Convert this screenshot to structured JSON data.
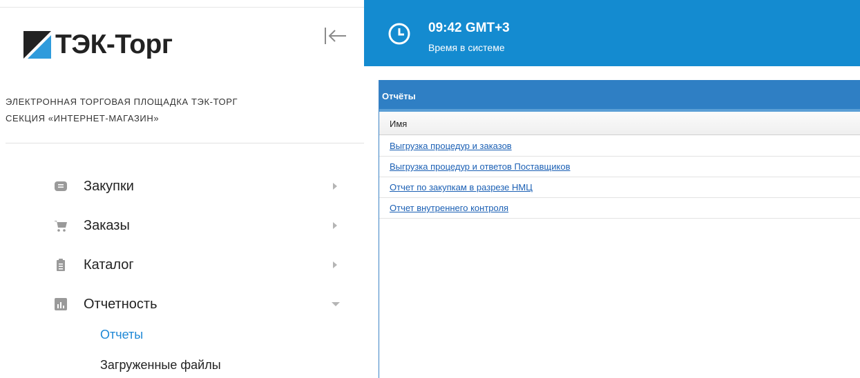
{
  "brand": {
    "logo_text": "ТЭК-Торг",
    "subtitle_line1": "Электронная торговая площадка ТЭК-Торг",
    "subtitle_line2": "Секция «Интернет-магазин»"
  },
  "sidebar": {
    "collapse_icon": "collapse-left-icon",
    "items": [
      {
        "label": "Закупки",
        "icon": "envelope-icon",
        "state": "collapsed"
      },
      {
        "label": "Заказы",
        "icon": "cart-icon",
        "state": "collapsed"
      },
      {
        "label": "Каталог",
        "icon": "clipboard-icon",
        "state": "collapsed"
      },
      {
        "label": "Отчетность",
        "icon": "bar-chart-icon",
        "state": "expanded"
      }
    ],
    "sub_items": [
      {
        "label": "Отчеты",
        "active": true
      },
      {
        "label": "Загруженные файлы",
        "active": false
      }
    ]
  },
  "header": {
    "time": "09:42 GMT+3",
    "caption": "Время в системе"
  },
  "reports": {
    "title": "Отчёты",
    "column_name": "Имя",
    "rows": [
      "Выгрузка процедур и заказов",
      "Выгрузка процедур и ответов Поставщиков",
      "Отчет по закупкам в разрезе НМЦ",
      "Отчет внутреннего контроля"
    ]
  },
  "colors": {
    "header_bg": "#148bd0",
    "panel_title_bg": "#2f7fc4",
    "link": "#1a5fb4",
    "active_sub_item": "#1e88d6"
  }
}
